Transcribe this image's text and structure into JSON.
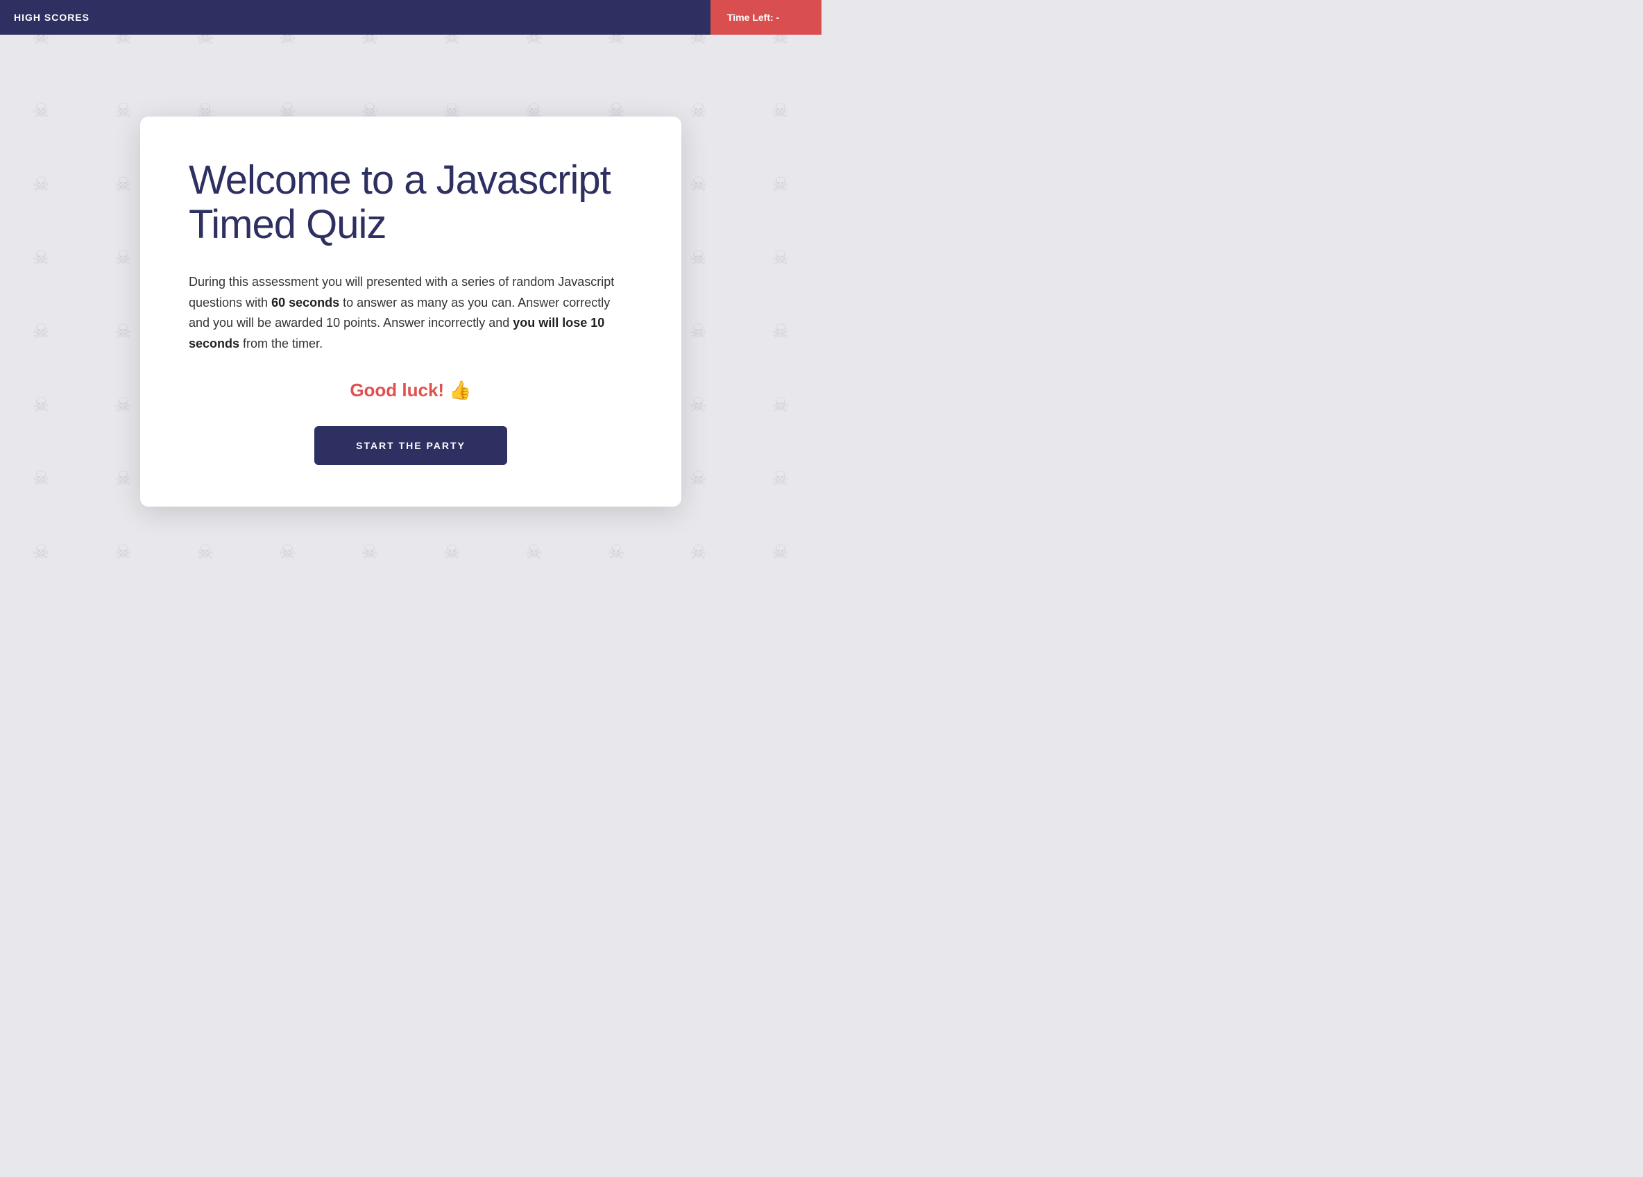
{
  "header": {
    "high_scores_label": "HIGH SCORES",
    "timer_label": "Time Left:",
    "timer_value": "-"
  },
  "card": {
    "title": "Welcome to a Javascript Timed Quiz",
    "description_part1": "During this assessment you will presented with a series of random Javascript questions with ",
    "bold1": "60 seconds",
    "description_part2": " to answer as many as you can. Answer correctly and you will be awarded 10 points. Answer incorrectly and ",
    "bold2": "you will lose 10 seconds",
    "description_part3": " from the timer.",
    "good_luck": "Good luck! 👍",
    "start_button_label": "START THE PARTY"
  },
  "background": {
    "skull_symbol": "☠"
  }
}
